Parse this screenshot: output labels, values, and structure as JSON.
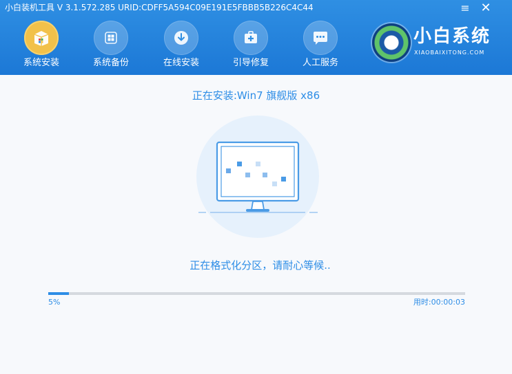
{
  "window": {
    "title": "小白装机工具 V 3.1.572.285 URID:CDFF5A594C09E191E5FBBB5B226C4C44",
    "minimize_glyph": "≡",
    "close_glyph": "✕"
  },
  "nav": {
    "active_index": 0,
    "items": [
      {
        "label": "系统安装",
        "icon": "package-icon"
      },
      {
        "label": "系统备份",
        "icon": "windows-backup-icon"
      },
      {
        "label": "在线安装",
        "icon": "download-icon"
      },
      {
        "label": "引导修复",
        "icon": "medical-kit-icon"
      },
      {
        "label": "人工服务",
        "icon": "chat-bubble-icon"
      }
    ]
  },
  "brand": {
    "name": "小白系统",
    "subtitle": "XIAOBAIXITONG.COM"
  },
  "install": {
    "title": "正在安装:Win7 旗舰版 x86",
    "status": "正在格式化分区，请耐心等候..",
    "progress_fraction": 0.05,
    "percent_text": "5%",
    "elapsed_text": "用时:00:00:03"
  },
  "colors": {
    "header": "#1f7bd8",
    "accent": "#2d8de6",
    "active_icon": "#f2c14a",
    "background": "#f7f9fc"
  }
}
